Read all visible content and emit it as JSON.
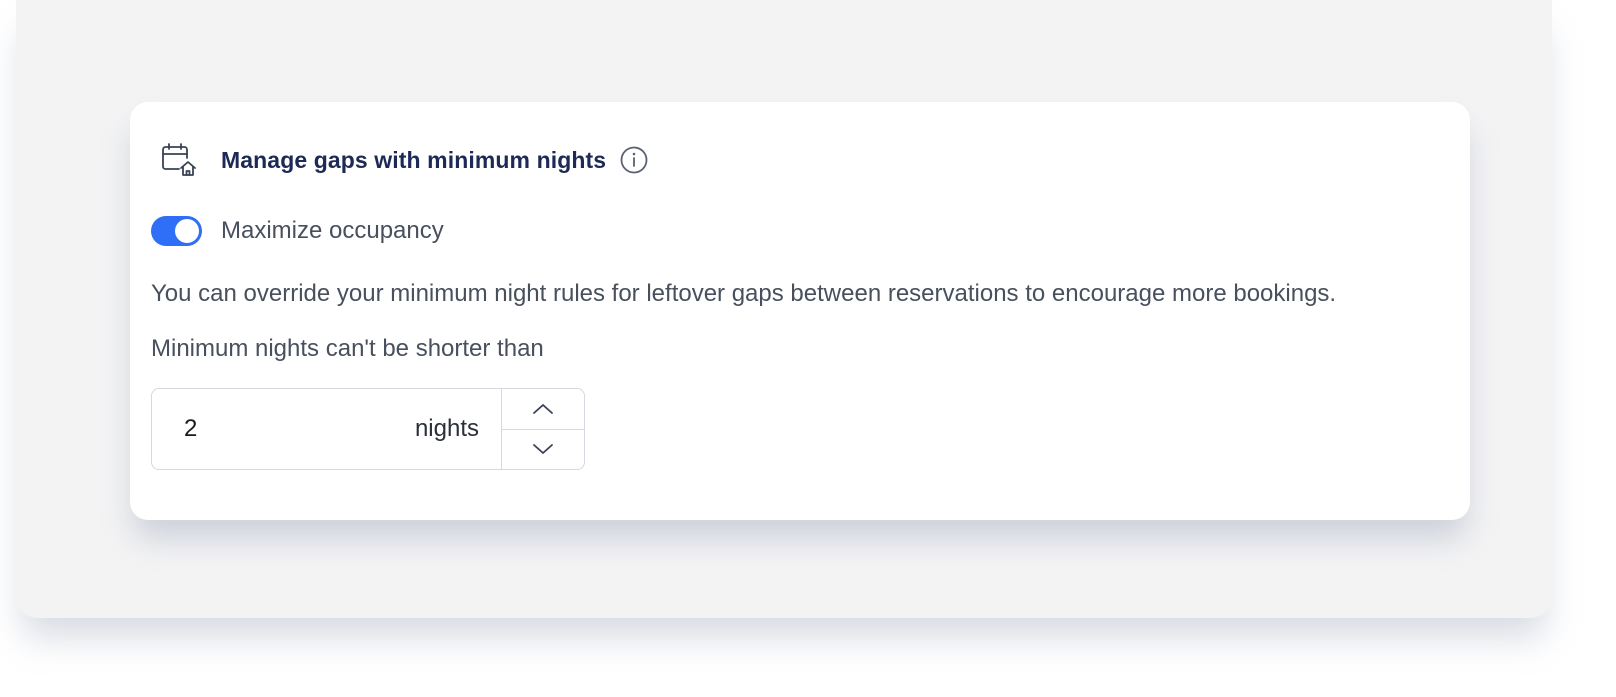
{
  "section": {
    "title": "Manage gaps with minimum nights",
    "icons": {
      "header": "calendar-house-icon",
      "info": "info-icon",
      "increment": "chevron-up-icon",
      "decrement": "chevron-down-icon"
    }
  },
  "toggle": {
    "label": "Maximize occupancy",
    "enabled": true,
    "color": "#2f6ef6"
  },
  "description": "You can override your minimum night rules for leftover gaps between reservations to encourage more bookings.",
  "minimum_nights": {
    "label": "Minimum nights can't be shorter than",
    "value": "2",
    "unit": "nights"
  },
  "colors": {
    "title": "#1d2a55",
    "text": "#48505e",
    "background": "#f3f3f4",
    "card": "#ffffff"
  }
}
